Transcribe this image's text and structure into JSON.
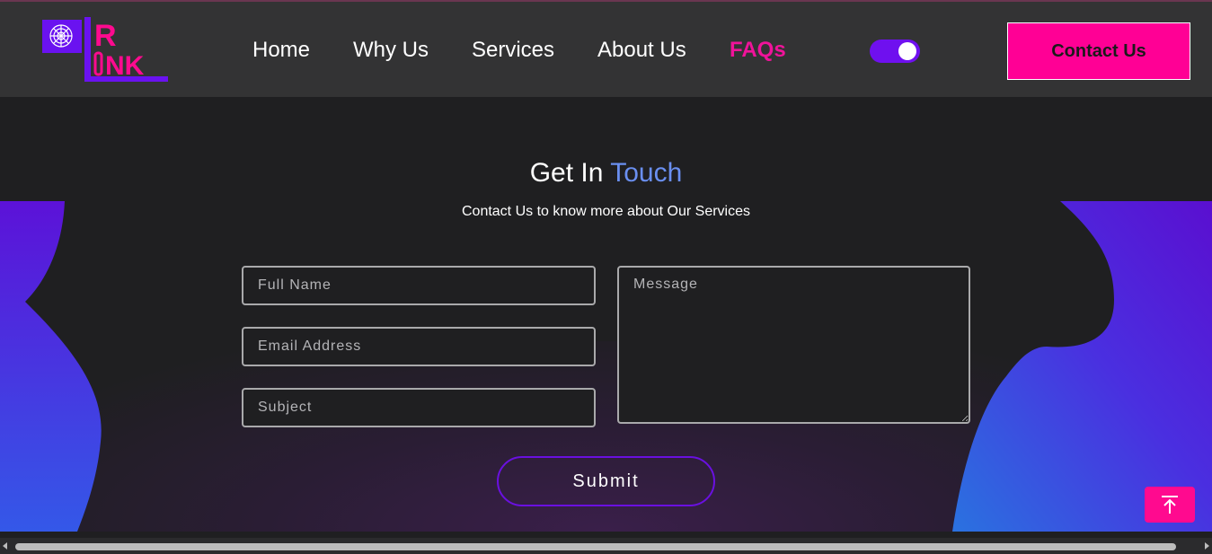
{
  "header": {
    "nav": [
      {
        "label": "Home",
        "active": false
      },
      {
        "label": "Why Us",
        "active": false
      },
      {
        "label": "Services",
        "active": false
      },
      {
        "label": "About Us",
        "active": false
      },
      {
        "label": "FAQs",
        "active": true
      }
    ],
    "theme_toggle_on": true,
    "contact_label": "Contact Us"
  },
  "contact": {
    "title_plain": "Get In",
    "title_accent": "Touch",
    "subtitle": "Contact Us to know more about Our Services",
    "full_name_placeholder": "Full Name",
    "email_placeholder": "Email Address",
    "subject_placeholder": "Subject",
    "message_placeholder": "Message",
    "submit_label": "Submit"
  },
  "colors": {
    "accent_pink": "#ff0095",
    "accent_purple": "#6f10ef",
    "accent_blue": "#6a8ff0",
    "background": "#1f1f21"
  },
  "icons": {
    "logo": "web-logo",
    "back_to_top": "arrow-up-to-line-icon"
  }
}
